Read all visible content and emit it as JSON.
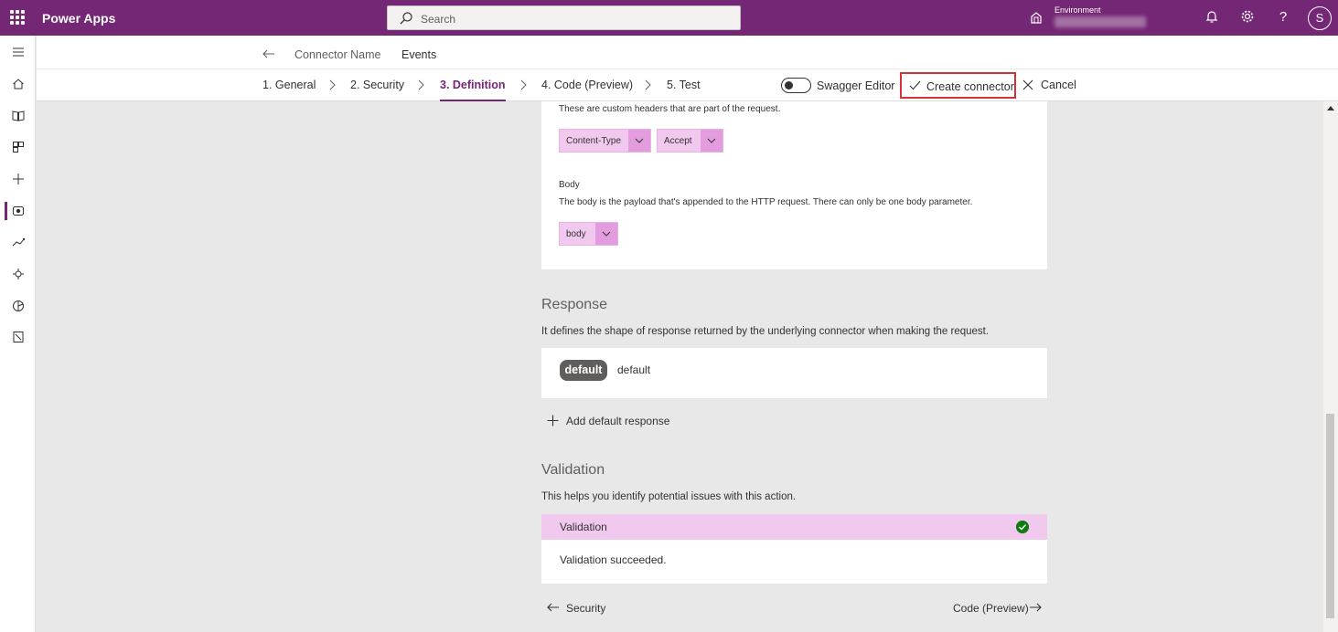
{
  "topbar": {
    "app_title": "Power Apps",
    "search_placeholder": "Search",
    "environment_label": "Environment",
    "avatar_initial": "S"
  },
  "header": {
    "connector_name": "Connector Name",
    "page_name": "Events",
    "steps": [
      {
        "label": "1. General"
      },
      {
        "label": "2. Security"
      },
      {
        "label": "3. Definition"
      },
      {
        "label": "4. Code (Preview)"
      },
      {
        "label": "5. Test"
      }
    ],
    "swagger_label": "Swagger Editor",
    "create_label": "Create connector",
    "cancel_label": "Cancel"
  },
  "request": {
    "headers_desc": "These are custom headers that are part of the request.",
    "header_params": [
      "Content-Type",
      "Accept"
    ],
    "body_title": "Body",
    "body_desc": "The body is the payload that's appended to the HTTP request. There can only be one body parameter.",
    "body_params": [
      "body"
    ]
  },
  "response": {
    "title": "Response",
    "desc": "It defines the shape of response returned by the underlying connector when making the request.",
    "pill": "default",
    "pill_label": "default",
    "add_label": "Add default response"
  },
  "validation": {
    "title": "Validation",
    "desc": "This helps you identify potential issues with this action.",
    "panel_title": "Validation",
    "result": "Validation succeeded."
  },
  "footer": {
    "prev_label": "Security",
    "next_label": "Code (Preview)"
  },
  "colors": {
    "brand": "#742774",
    "chip": "#f2c9ee",
    "success": "#107c10",
    "highlight_border": "#d13438"
  }
}
